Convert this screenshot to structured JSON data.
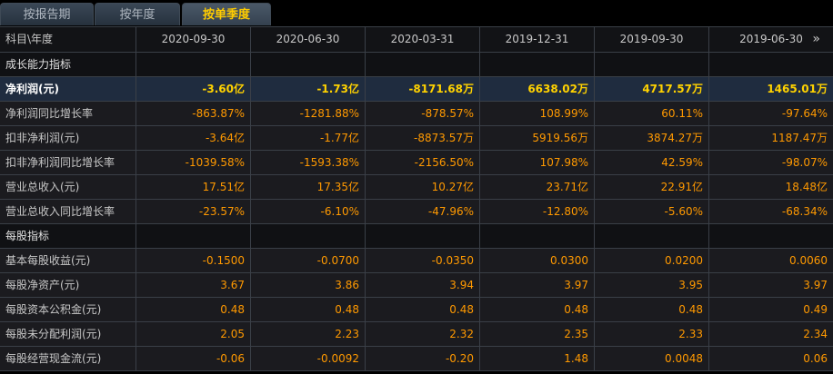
{
  "tabs": [
    "按报告期",
    "按年度",
    "按单季度"
  ],
  "header": {
    "label": "科目\\年度",
    "dates": [
      "2020-09-30",
      "2020-06-30",
      "2020-03-31",
      "2019-12-31",
      "2019-09-30",
      "2019-06-30"
    ],
    "next_icon": "»"
  },
  "rows": [
    {
      "type": "section",
      "label": "成长能力指标",
      "values": [
        "",
        "",
        "",
        "",
        "",
        ""
      ]
    },
    {
      "type": "highlight",
      "label": "净利润(元)",
      "values": [
        "-3.60亿",
        "-1.73亿",
        "-8171.68万",
        "6638.02万",
        "4717.57万",
        "1465.01万"
      ]
    },
    {
      "type": "data",
      "label": "净利润同比增长率",
      "values": [
        "-863.87%",
        "-1281.88%",
        "-878.57%",
        "108.99%",
        "60.11%",
        "-97.64%"
      ]
    },
    {
      "type": "data",
      "label": "扣非净利润(元)",
      "values": [
        "-3.64亿",
        "-1.77亿",
        "-8873.57万",
        "5919.56万",
        "3874.27万",
        "1187.47万"
      ]
    },
    {
      "type": "data",
      "label": "扣非净利润同比增长率",
      "values": [
        "-1039.58%",
        "-1593.38%",
        "-2156.50%",
        "107.98%",
        "42.59%",
        "-98.07%"
      ]
    },
    {
      "type": "data",
      "label": "营业总收入(元)",
      "values": [
        "17.51亿",
        "17.35亿",
        "10.27亿",
        "23.71亿",
        "22.91亿",
        "18.48亿"
      ]
    },
    {
      "type": "data",
      "label": "营业总收入同比增长率",
      "values": [
        "-23.57%",
        "-6.10%",
        "-47.96%",
        "-12.80%",
        "-5.60%",
        "-68.34%"
      ]
    },
    {
      "type": "section",
      "label": "每股指标",
      "values": [
        "",
        "",
        "",
        "",
        "",
        ""
      ]
    },
    {
      "type": "data",
      "label": "基本每股收益(元)",
      "values": [
        "-0.1500",
        "-0.0700",
        "-0.0350",
        "0.0300",
        "0.0200",
        "0.0060"
      ]
    },
    {
      "type": "data",
      "label": "每股净资产(元)",
      "values": [
        "3.67",
        "3.86",
        "3.94",
        "3.97",
        "3.95",
        "3.97"
      ]
    },
    {
      "type": "data",
      "label": "每股资本公积金(元)",
      "values": [
        "0.48",
        "0.48",
        "0.48",
        "0.48",
        "0.48",
        "0.49"
      ]
    },
    {
      "type": "data",
      "label": "每股未分配利润(元)",
      "values": [
        "2.05",
        "2.23",
        "2.32",
        "2.35",
        "2.33",
        "2.34"
      ]
    },
    {
      "type": "data",
      "label": "每股经营现金流(元)",
      "values": [
        "-0.06",
        "-0.0092",
        "-0.20",
        "1.48",
        "0.0048",
        "0.06"
      ]
    }
  ]
}
